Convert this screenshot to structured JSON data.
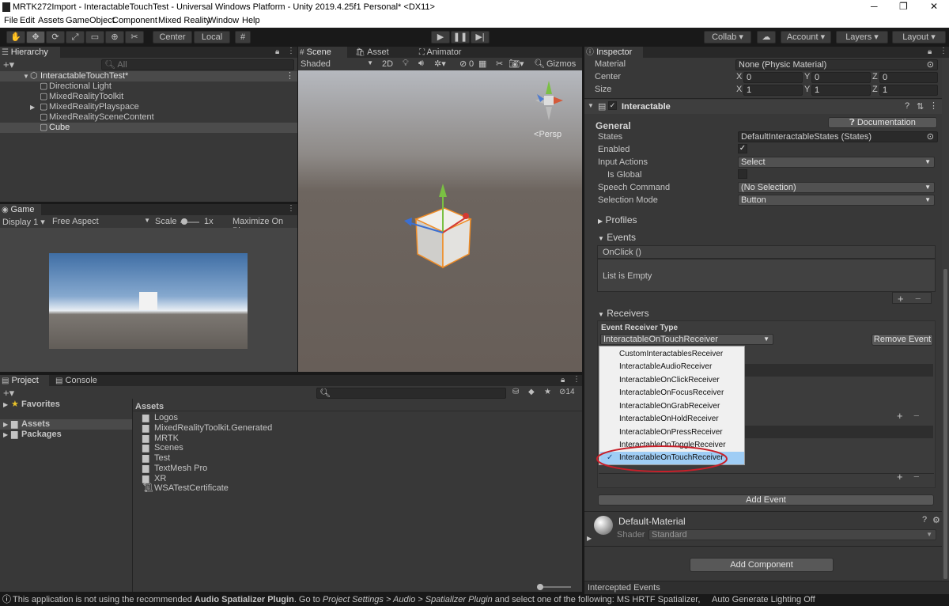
{
  "window": {
    "title": "MRTK272Import - InteractableTouchTest - Universal Windows Platform - Unity 2019.4.25f1 Personal* <DX11>"
  },
  "menu": [
    "File",
    "Edit",
    "Assets",
    "GameObject",
    "Component",
    "Mixed Reality",
    "Window",
    "Help"
  ],
  "toolbar": {
    "center": "Center",
    "local": "Local",
    "collab": "Collab",
    "account": "Account",
    "layers": "Layers",
    "layout": "Layout"
  },
  "hierarchy": {
    "tab": "Hierarchy",
    "search_placeholder": "All",
    "scene": "InteractableTouchTest*",
    "items": [
      "Directional Light",
      "MixedRealityToolkit",
      "MixedRealityPlayspace",
      "MixedRealitySceneContent",
      "Cube"
    ]
  },
  "scene": {
    "tabs": [
      "Scene",
      "Asset Store",
      "Animator"
    ],
    "shading": "Shaded",
    "mode_2d": "2D",
    "hidden_count": "0",
    "gizmos": "Gizmos",
    "persp": "Persp"
  },
  "game": {
    "tab": "Game",
    "display": "Display 1",
    "aspect": "Free Aspect",
    "scale_label": "Scale",
    "scale_value": "1x",
    "maximize": "Maximize On Play"
  },
  "project": {
    "tabs": [
      "Project",
      "Console"
    ],
    "sidebar": [
      "Favorites",
      "Assets",
      "Packages"
    ],
    "breadcrumb": "Assets",
    "hidden_count": "14",
    "items": [
      "Logos",
      "MixedRealityToolkit.Generated",
      "MRTK",
      "Scenes",
      "Test",
      "TextMesh Pro",
      "XR",
      "WSATestCertificate"
    ]
  },
  "inspector": {
    "tab": "Inspector",
    "material_label": "Material",
    "material_value": "None (Physic Material)",
    "center_label": "Center",
    "center": {
      "x": "0",
      "y": "0",
      "z": "0"
    },
    "size_label": "Size",
    "size": {
      "x": "1",
      "y": "1",
      "z": "1"
    },
    "axis": [
      "X",
      "Y",
      "Z"
    ],
    "component": "Interactable",
    "general": "General",
    "documentation": "Documentation",
    "states_label": "States",
    "states_value": "DefaultInteractableStates (States)",
    "enabled_label": "Enabled",
    "enabled": true,
    "input_actions_label": "Input Actions",
    "input_actions_value": "Select",
    "is_global_label": "Is Global",
    "is_global": false,
    "speech_label": "Speech Command",
    "speech_value": "(No Selection)",
    "selection_label": "Selection Mode",
    "selection_value": "Button",
    "profiles": "Profiles",
    "events": "Events",
    "onclick": "OnClick ()",
    "list_empty": "List is Empty",
    "plus": "+",
    "minus": "−",
    "receivers": "Receivers",
    "receiver_type_label": "Event Receiver Type",
    "receiver_type_value": "InteractableOnTouchReceiver",
    "remove_event": "Remove Event",
    "add_event": "Add Event",
    "material_name": "Default-Material",
    "shader_label": "Shader",
    "shader_value": "Standard",
    "add_component": "Add Component",
    "intercepted": "Intercepted Events"
  },
  "receiver_options": [
    "CustomInteractablesReceiver",
    "InteractableAudioReceiver",
    "InteractableOnClickReceiver",
    "InteractableOnFocusReceiver",
    "InteractableOnGrabReceiver",
    "InteractableOnHoldReceiver",
    "InteractableOnPressReceiver",
    "InteractableOnToggleReceiver",
    "InteractableOnTouchReceiver"
  ],
  "selected_receiver": "InteractableOnTouchReceiver",
  "status": {
    "message_1": "This application is not using the recommended ",
    "message_2": "Audio Spatializer Plugin",
    "message_3": ". Go to ",
    "message_4": "Project Settings > Audio > Spatializer Plugin",
    "message_5": " and select one of the following: MS HRTF Spatializer, Microsoft S",
    "lighting": "Auto Generate Lighting Off"
  },
  "colors": {
    "accent_select": "#9fcdf5",
    "highlight_ring": "#c8202a",
    "panel": "#383838"
  }
}
